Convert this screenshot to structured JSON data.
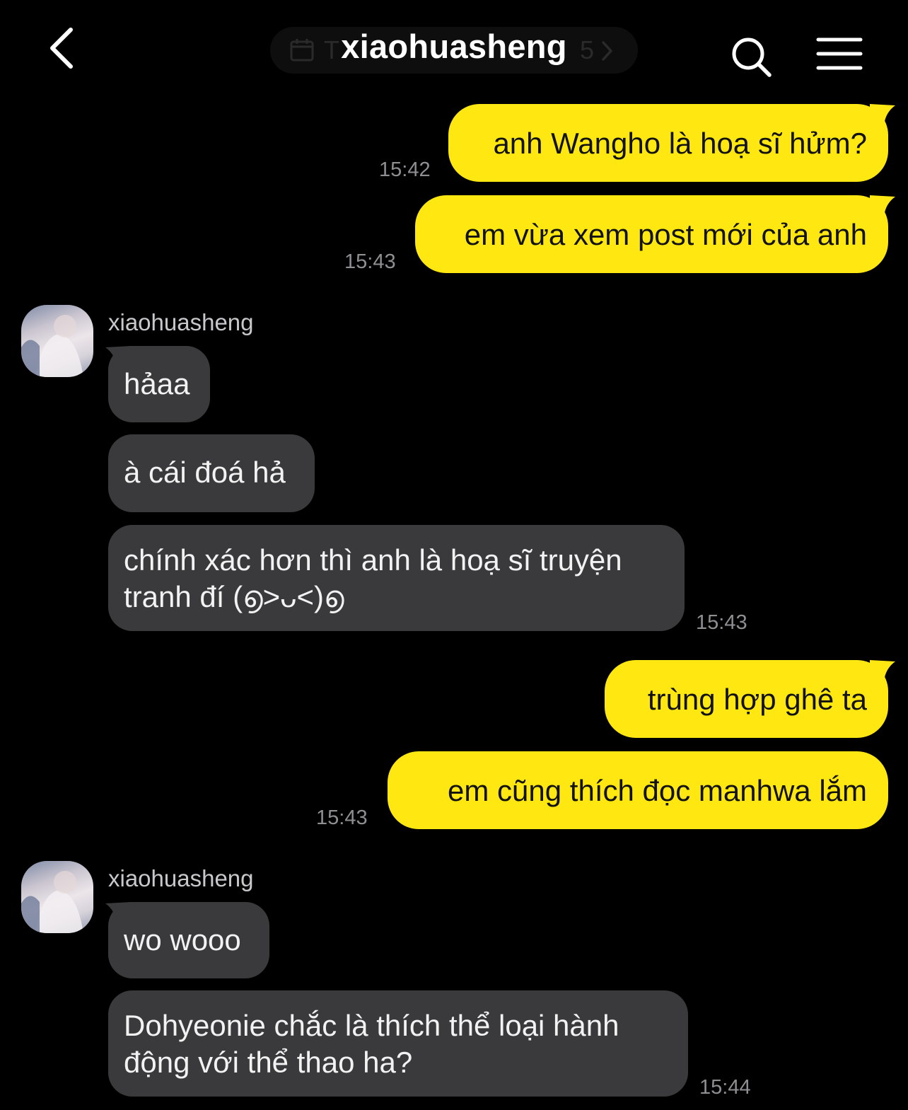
{
  "header": {
    "title": "xiaohuasheng",
    "date_label": "T",
    "date_suffix": "5"
  },
  "messages": [
    {
      "side": "out",
      "text": "anh Wangho là hoạ sĩ hửm?",
      "time": "15:42"
    },
    {
      "side": "out",
      "text": "em vừa xem post mới của anh",
      "time": "15:43"
    },
    {
      "side": "in",
      "sender": "xiaohuasheng",
      "text": "hảaa"
    },
    {
      "side": "in",
      "text": "à cái đoá hả"
    },
    {
      "side": "in",
      "line1": "chính xác hơn thì anh là hoạ sĩ truyện",
      "line2": "tranh đí (൭˃ᴗ˂)൭",
      "time": "15:43"
    },
    {
      "side": "out",
      "text": "trùng hợp ghê ta"
    },
    {
      "side": "out",
      "text": "em cũng thích đọc manhwa lắm",
      "time": "15:43"
    },
    {
      "side": "in",
      "sender": "xiaohuasheng",
      "text": "wo wooo"
    },
    {
      "side": "in",
      "line1": "Dohyeonie chắc là thích thể loại hành",
      "line2": "động với thể thao ha?",
      "time": "15:44"
    }
  ],
  "colors": {
    "background": "#000000",
    "outgoing_bubble": "#ffe812",
    "incoming_bubble": "#3a3a3c",
    "timestamp": "#8e8e93"
  },
  "icons": {
    "back": "chevron-left-icon",
    "search": "search-icon",
    "menu": "hamburger-menu-icon",
    "calendar": "calendar-icon"
  }
}
